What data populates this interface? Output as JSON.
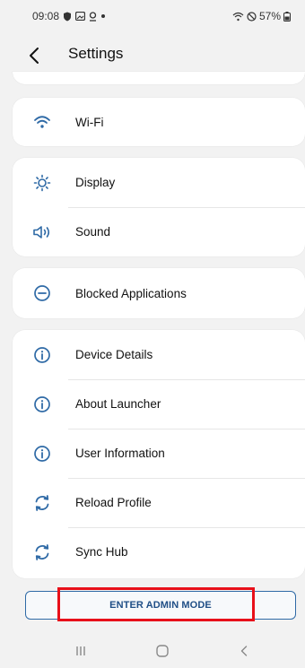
{
  "status_bar": {
    "time": "09:08",
    "battery": "57%"
  },
  "header": {
    "title": "Settings"
  },
  "sections": {
    "network": [
      {
        "label": "Wi-Fi",
        "icon": "wifi-icon"
      }
    ],
    "display_sound": [
      {
        "label": "Display",
        "icon": "brightness-icon"
      },
      {
        "label": "Sound",
        "icon": "speaker-icon"
      }
    ],
    "blocked": [
      {
        "label": "Blocked Applications",
        "icon": "minus-circle-icon"
      }
    ],
    "info": [
      {
        "label": "Device Details",
        "icon": "info-icon"
      },
      {
        "label": "About Launcher",
        "icon": "info-icon"
      },
      {
        "label": "User Information",
        "icon": "info-icon"
      },
      {
        "label": "Reload Profile",
        "icon": "sync-icon"
      },
      {
        "label": "Sync Hub",
        "icon": "sync-icon"
      }
    ]
  },
  "admin_button": {
    "label": "ENTER ADMIN MODE"
  },
  "colors": {
    "accent": "#2f6aa6",
    "highlight": "#e8101a",
    "background": "#f2f2f2",
    "card": "#ffffff"
  }
}
